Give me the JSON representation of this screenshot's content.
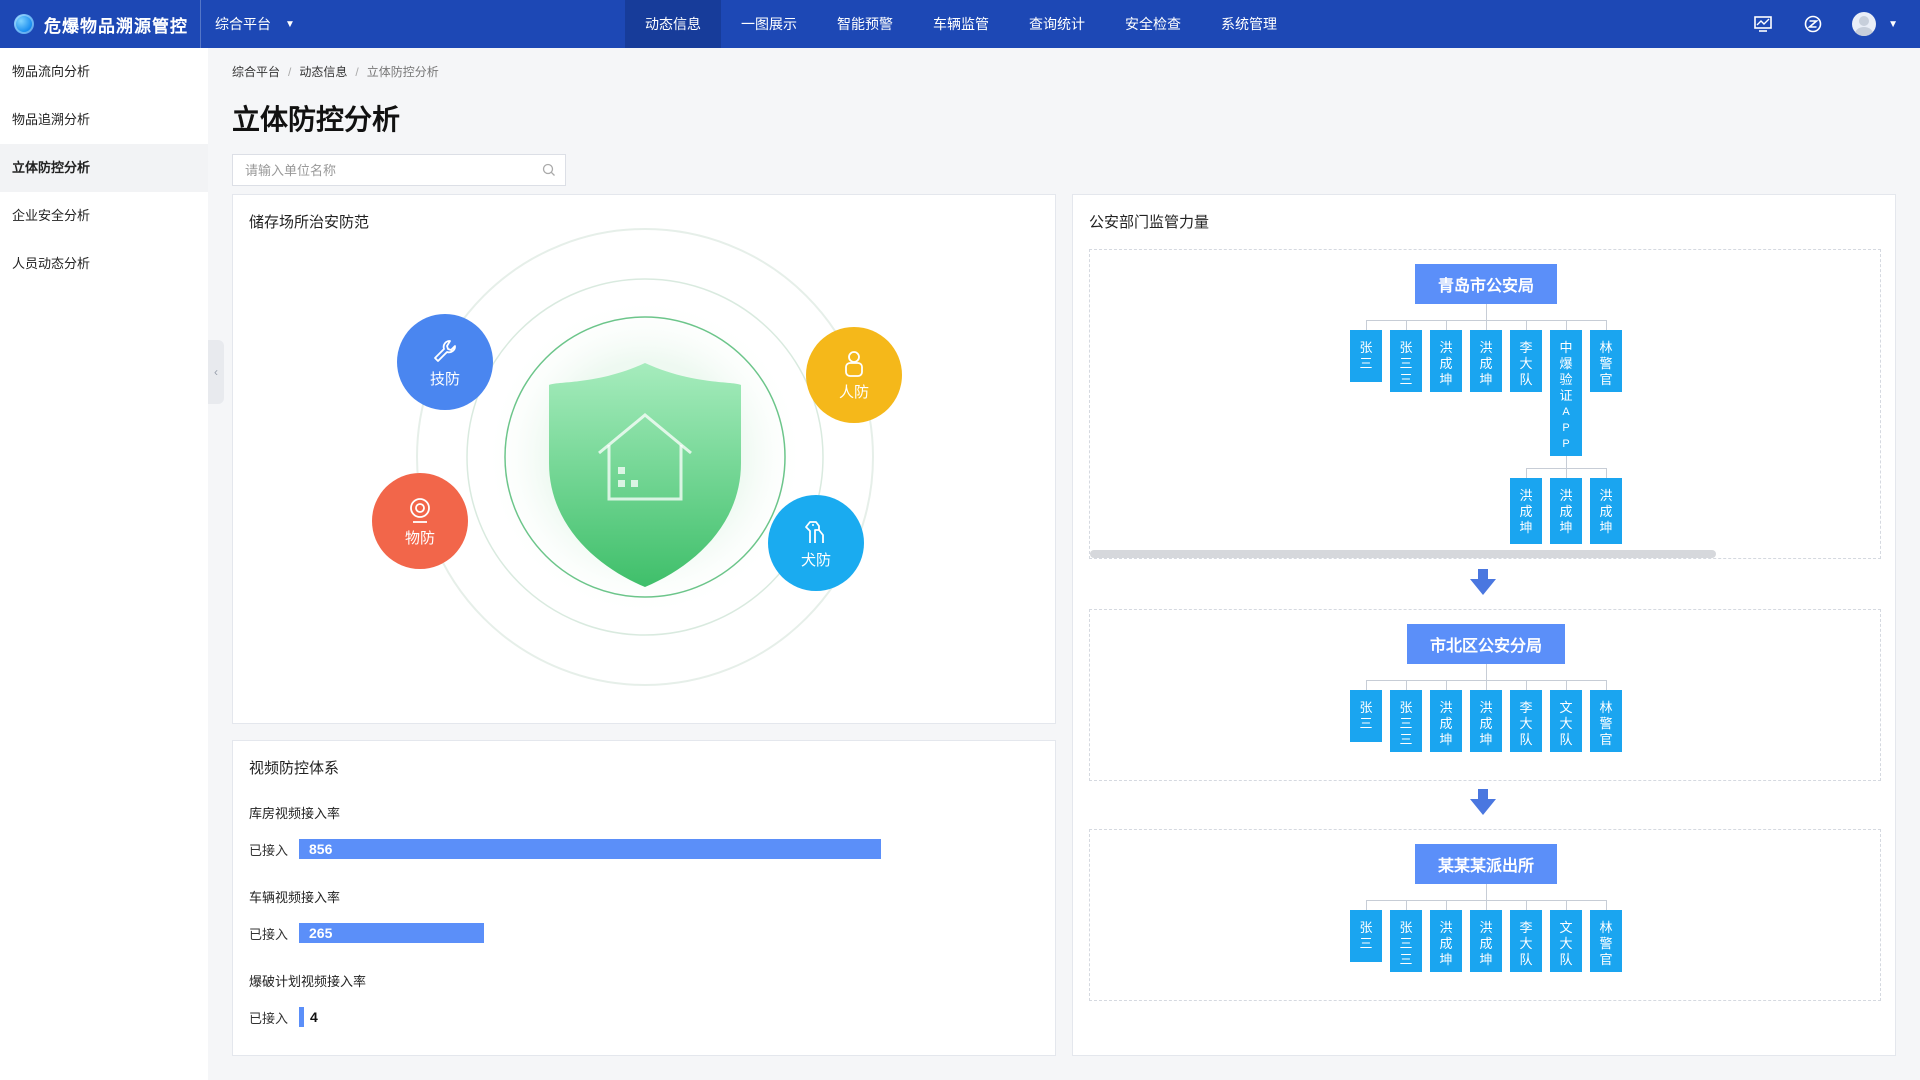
{
  "app": {
    "title": "危爆物品溯源管控",
    "platform": "综合平台"
  },
  "nav": [
    "动态信息",
    "一图展示",
    "智能预警",
    "车辆监管",
    "查询统计",
    "安全检查",
    "系统管理"
  ],
  "sidebar": [
    "物品流向分析",
    "物品追溯分析",
    "立体防控分析",
    "企业安全分析",
    "人员动态分析"
  ],
  "breadcrumb": [
    "综合平台",
    "动态信息",
    "立体防控分析"
  ],
  "page_title": "立体防控分析",
  "search": {
    "placeholder": "请输入单位名称"
  },
  "storage": {
    "title": "储存场所治安防范",
    "nodes": {
      "tech": "技防",
      "people": "人防",
      "object": "物防",
      "dog": "犬防"
    },
    "colors": {
      "tech": "#4a86f0",
      "people": "#f5b81a",
      "object": "#f2664a",
      "dog": "#1aabf0"
    }
  },
  "video": {
    "title": "视频防控体系",
    "rows": [
      {
        "label": "库房视频接入率",
        "key": "已接入",
        "value": "856"
      },
      {
        "label": "车辆视频接入率",
        "key": "已接入",
        "value": "265"
      },
      {
        "label": "爆破计划视频接入率",
        "key": "已接入",
        "value": "4"
      }
    ]
  },
  "org": {
    "title": "公安部门监管力量",
    "groups": [
      {
        "root": "青岛市公安局",
        "leaves": [
          "张三",
          "张三三",
          "洪成坤",
          "洪成坤",
          "李大队",
          "中爆验证APP",
          "林警官"
        ],
        "sub": [
          "洪成坤",
          "洪成坤",
          "洪成坤"
        ]
      },
      {
        "root": "市北区公安分局",
        "leaves": [
          "张三",
          "张三三",
          "洪成坤",
          "洪成坤",
          "李大队",
          "文大队",
          "林警官"
        ]
      },
      {
        "root": "某某某派出所",
        "leaves": [
          "张三",
          "张三三",
          "洪成坤",
          "洪成坤",
          "李大队",
          "文大队",
          "林警官"
        ]
      }
    ]
  }
}
